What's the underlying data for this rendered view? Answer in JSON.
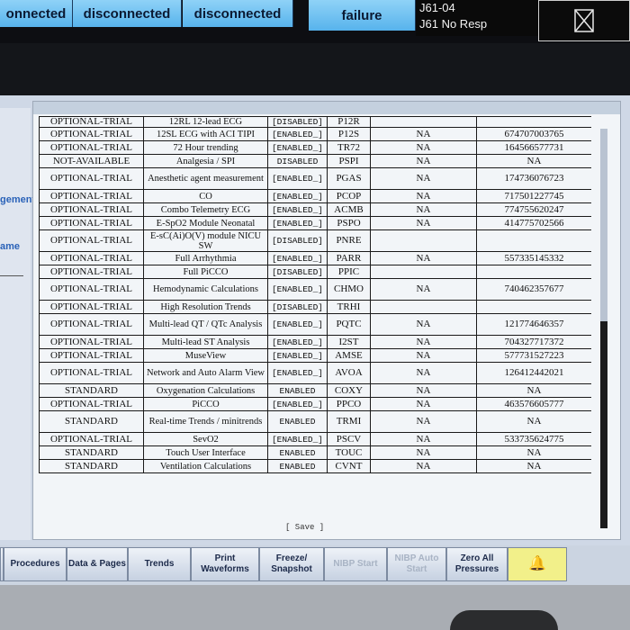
{
  "top_bar": {
    "status_buttons": [
      "onnected",
      "disconnected",
      "disconnected",
      "failure"
    ],
    "alarm_lines": [
      "J61-04",
      "J61 No Resp"
    ],
    "silence_icon": "audio-paused-icon"
  },
  "side_panel": {
    "labels": [
      "gement",
      "ame"
    ]
  },
  "options_table": {
    "partial_top_row": [
      "OPTIONAL-TRIAL",
      "12RL 12-lead ECG",
      "[DISABLED]",
      "P12R",
      "",
      ""
    ],
    "rows": [
      [
        "OPTIONAL-TRIAL",
        "12SL ECG with ACI TIPI",
        "[ENABLED_]",
        "P12S",
        "NA",
        "674707003765"
      ],
      [
        "OPTIONAL-TRIAL",
        "72 Hour trending",
        "[ENABLED_]",
        "TR72",
        "NA",
        "164566577731"
      ],
      [
        "NOT-AVAILABLE",
        "Analgesia / SPI",
        "DISABLED",
        "PSPI",
        "NA",
        "NA"
      ],
      [
        "OPTIONAL-TRIAL",
        "Anesthetic agent measurement",
        "[ENABLED_]",
        "PGAS",
        "NA",
        "174736076723"
      ],
      [
        "OPTIONAL-TRIAL",
        "CO",
        "[ENABLED_]",
        "PCOP",
        "NA",
        "717501227745"
      ],
      [
        "OPTIONAL-TRIAL",
        "Combo Telemetry ECG",
        "[ENABLED_]",
        "ACMB",
        "NA",
        "774755620247"
      ],
      [
        "OPTIONAL-TRIAL",
        "E-SpO2 Module Neonatal",
        "[ENABLED_]",
        "PSPO",
        "NA",
        "414775702566"
      ],
      [
        "OPTIONAL-TRIAL",
        "E-sC(Ai)O(V) module NICU SW",
        "[DISABLED]",
        "PNRE",
        "",
        ""
      ],
      [
        "OPTIONAL-TRIAL",
        "Full Arrhythmia",
        "[ENABLED_]",
        "PARR",
        "NA",
        "557335145332"
      ],
      [
        "OPTIONAL-TRIAL",
        "Full PiCCO",
        "[DISABLED]",
        "PPIC",
        "",
        ""
      ],
      [
        "OPTIONAL-TRIAL",
        "Hemodynamic Calculations",
        "[ENABLED_]",
        "CHMO",
        "NA",
        "740462357677"
      ],
      [
        "OPTIONAL-TRIAL",
        "High Resolution Trends",
        "[DISABLED]",
        "TRHI",
        "",
        ""
      ],
      [
        "OPTIONAL-TRIAL",
        "Multi-lead QT / QTc Analysis",
        "[ENABLED_]",
        "PQTC",
        "NA",
        "121774646357"
      ],
      [
        "OPTIONAL-TRIAL",
        "Multi-lead ST Analysis",
        "[ENABLED_]",
        "I2ST",
        "NA",
        "704327717372"
      ],
      [
        "OPTIONAL-TRIAL",
        "MuseView",
        "[ENABLED_]",
        "AMSE",
        "NA",
        "577731527223"
      ],
      [
        "OPTIONAL-TRIAL",
        "Network and Auto Alarm View",
        "[ENABLED_]",
        "AVOA",
        "NA",
        "126412442021"
      ],
      [
        "STANDARD",
        "Oxygenation Calculations",
        "ENABLED",
        "COXY",
        "NA",
        "NA"
      ],
      [
        "OPTIONAL-TRIAL",
        "PiCCO",
        "[ENABLED_]",
        "PPCO",
        "NA",
        "463576605777"
      ],
      [
        "STANDARD",
        "Real-time Trends / minitrends",
        "ENABLED",
        "TRMI",
        "NA",
        "NA"
      ],
      [
        "OPTIONAL-TRIAL",
        "SevO2",
        "[ENABLED_]",
        "PSCV",
        "NA",
        "533735624775"
      ],
      [
        "STANDARD",
        "Touch User Interface",
        "ENABLED",
        "TOUC",
        "NA",
        "NA"
      ],
      [
        "STANDARD",
        "Ventilation Calculations",
        "ENABLED",
        "CVNT",
        "NA",
        "NA"
      ]
    ],
    "save_label": "[ Save ]"
  },
  "softkeys": [
    {
      "label": "",
      "dim": false
    },
    {
      "label": "Procedures",
      "dim": false
    },
    {
      "label": "Data & Pages",
      "dim": false
    },
    {
      "label": "Trends",
      "dim": false
    },
    {
      "label": "Print Waveforms",
      "dim": false
    },
    {
      "label": "Freeze/ Snapshot",
      "dim": false
    },
    {
      "label": "NIBP Start",
      "dim": true
    },
    {
      "label": "NIBP Auto Start",
      "dim": true
    },
    {
      "label": "Zero All Pressures",
      "dim": false
    },
    {
      "label": "",
      "dim": false,
      "icon": "alarm-bell-icon"
    }
  ]
}
